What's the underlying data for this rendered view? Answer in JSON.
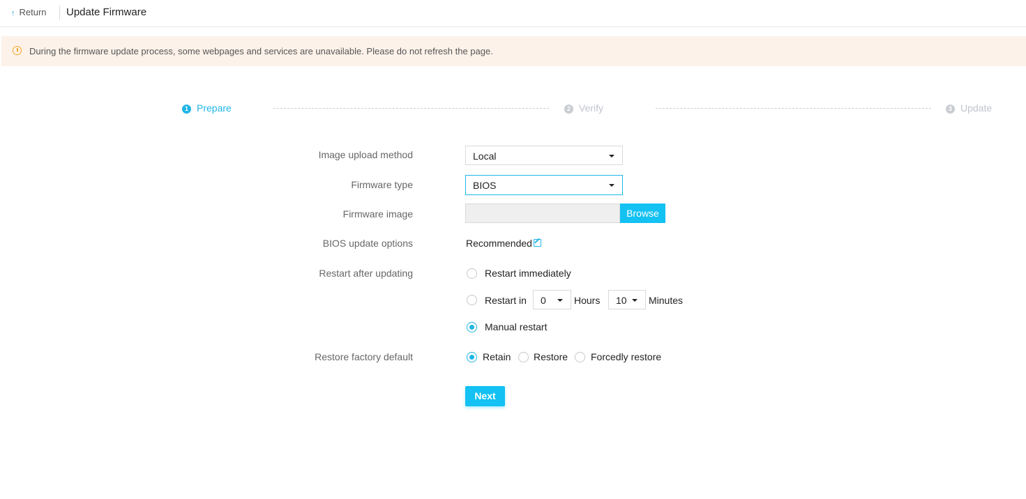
{
  "header": {
    "return_label": "Return",
    "title": "Update Firmware"
  },
  "warning": {
    "icon": "info-icon",
    "text": "During the firmware update process, some webpages and services are unavailable. Please do not refresh the page."
  },
  "steps": [
    {
      "num": "1",
      "label": "Prepare",
      "state": "active"
    },
    {
      "num": "2",
      "label": "Verify",
      "state": "inactive"
    },
    {
      "num": "3",
      "label": "Update",
      "state": "inactive"
    }
  ],
  "form": {
    "upload_method": {
      "label": "Image upload method",
      "value": "Local"
    },
    "firmware_type": {
      "label": "Firmware type",
      "value": "BIOS"
    },
    "firmware_image": {
      "label": "Firmware image",
      "value": "",
      "browse_label": "Browse"
    },
    "bios_options": {
      "label": "BIOS update options",
      "value": "Recommended",
      "edit_icon": "edit-icon"
    },
    "restart": {
      "label": "Restart after updating",
      "immediately": "Restart immediately",
      "restart_in": "Restart in",
      "hours_value": "0",
      "hours_label": "Hours",
      "minutes_value": "10",
      "minutes_label": "Minutes",
      "manual": "Manual restart",
      "selected": "manual"
    },
    "restore": {
      "label": "Restore factory default",
      "retain": "Retain",
      "restore": "Restore",
      "forced": "Forcedly restore",
      "selected": "retain"
    },
    "next_label": "Next"
  },
  "colors": {
    "accent": "#1fb5e6",
    "button": "#13c1f3",
    "warning_bg": "#fdf2e9",
    "warning_icon": "#f5a623",
    "inactive": "#c0c4cc"
  }
}
